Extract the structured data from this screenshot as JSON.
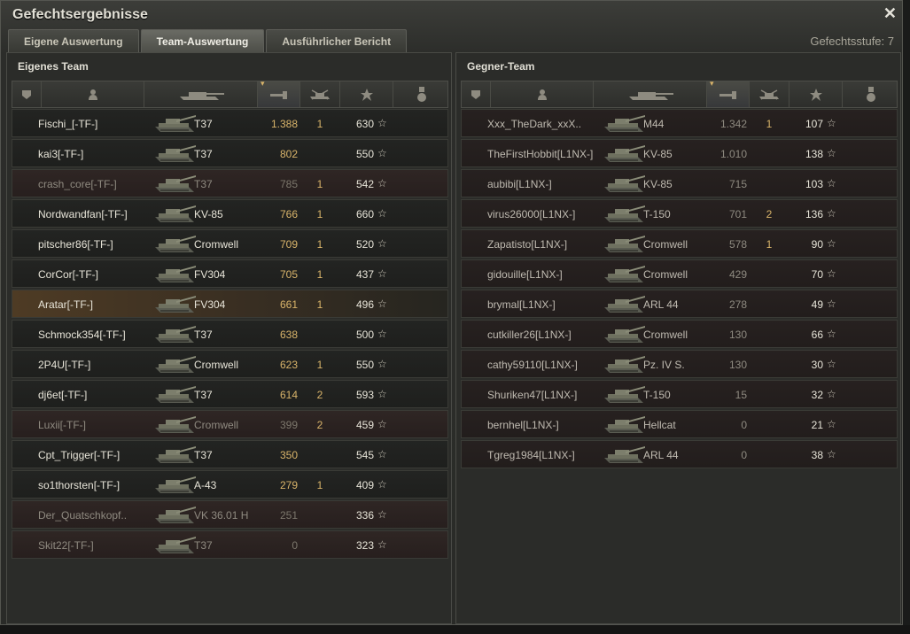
{
  "window": {
    "title": "Gefechtsergebnisse",
    "close_glyph": "✕",
    "battle_level": "Gefechtsstufe: 7"
  },
  "tabs": [
    {
      "label": "Eigene Auswertung",
      "active": false
    },
    {
      "label": "Team-Auswertung",
      "active": true
    },
    {
      "label": "Ausführlicher Bericht",
      "active": false
    }
  ],
  "columns": [
    "platoon-icon",
    "player-icon",
    "tank-icon",
    "xp-icon",
    "kills-icon",
    "points-icon",
    "medal-icon"
  ],
  "star_glyph": "☆",
  "own_team": {
    "title": "Eigenes Team",
    "rows": [
      {
        "name": "Fischi_[-TF-]",
        "tank": "T37",
        "xp": "1.388",
        "kills": "1",
        "points": "630",
        "state": "alive"
      },
      {
        "name": "kai3[-TF-]",
        "tank": "T37",
        "xp": "802",
        "kills": "",
        "points": "550",
        "state": "alive"
      },
      {
        "name": "crash_core[-TF-]",
        "tank": "T37",
        "xp": "785",
        "kills": "1",
        "points": "542",
        "state": "dead"
      },
      {
        "name": "Nordwandfan[-TF-]",
        "tank": "KV-85",
        "xp": "766",
        "kills": "1",
        "points": "660",
        "state": "alive"
      },
      {
        "name": "pitscher86[-TF-]",
        "tank": "Cromwell",
        "xp": "709",
        "kills": "1",
        "points": "520",
        "state": "alive"
      },
      {
        "name": "CorCor[-TF-]",
        "tank": "FV304",
        "xp": "705",
        "kills": "1",
        "points": "437",
        "state": "alive"
      },
      {
        "name": "Aratar[-TF-]",
        "tank": "FV304",
        "xp": "661",
        "kills": "1",
        "points": "496",
        "state": "self"
      },
      {
        "name": "Schmock354[-TF-]",
        "tank": "T37",
        "xp": "638",
        "kills": "",
        "points": "500",
        "state": "alive"
      },
      {
        "name": "2P4U[-TF-]",
        "tank": "Cromwell",
        "xp": "623",
        "kills": "1",
        "points": "550",
        "state": "alive"
      },
      {
        "name": "dj6et[-TF-]",
        "tank": "T37",
        "xp": "614",
        "kills": "2",
        "points": "593",
        "state": "alive"
      },
      {
        "name": "Luxii[-TF-]",
        "tank": "Cromwell",
        "xp": "399",
        "kills": "2",
        "points": "459",
        "state": "dead"
      },
      {
        "name": "Cpt_Trigger[-TF-]",
        "tank": "T37",
        "xp": "350",
        "kills": "",
        "points": "545",
        "state": "alive"
      },
      {
        "name": "so1thorsten[-TF-]",
        "tank": "A-43",
        "xp": "279",
        "kills": "1",
        "points": "409",
        "state": "alive"
      },
      {
        "name": "Der_Quatschkopf..",
        "tank": "VK 36.01 H",
        "xp": "251",
        "kills": "",
        "points": "336",
        "state": "dead"
      },
      {
        "name": "Skit22[-TF-]",
        "tank": "T37",
        "xp": "0",
        "kills": "",
        "points": "323",
        "state": "dead"
      }
    ]
  },
  "enemy_team": {
    "title": "Gegner-Team",
    "rows": [
      {
        "name": "Xxx_TheDark_xxX..",
        "tank": "M44",
        "xp": "1.342",
        "kills": "1",
        "points": "107"
      },
      {
        "name": "TheFirstHobbit[L1NX-]",
        "tank": "KV-85",
        "xp": "1.010",
        "kills": "",
        "points": "138"
      },
      {
        "name": "aubibi[L1NX-]",
        "tank": "KV-85",
        "xp": "715",
        "kills": "",
        "points": "103"
      },
      {
        "name": "virus26000[L1NX-]",
        "tank": "T-150",
        "xp": "701",
        "kills": "2",
        "points": "136"
      },
      {
        "name": "Zapatisto[L1NX-]",
        "tank": "Cromwell",
        "xp": "578",
        "kills": "1",
        "points": "90"
      },
      {
        "name": "gidouille[L1NX-]",
        "tank": "Cromwell",
        "xp": "429",
        "kills": "",
        "points": "70"
      },
      {
        "name": "brymal[L1NX-]",
        "tank": "ARL 44",
        "xp": "278",
        "kills": "",
        "points": "49"
      },
      {
        "name": "cutkiller26[L1NX-]",
        "tank": "Cromwell",
        "xp": "130",
        "kills": "",
        "points": "66"
      },
      {
        "name": "cathy59110[L1NX-]",
        "tank": "Pz. IV S.",
        "xp": "130",
        "kills": "",
        "points": "30"
      },
      {
        "name": "Shuriken47[L1NX-]",
        "tank": "T-150",
        "xp": "15",
        "kills": "",
        "points": "32"
      },
      {
        "name": "bernhel[L1NX-]",
        "tank": "Hellcat",
        "xp": "0",
        "kills": "",
        "points": "21"
      },
      {
        "name": "Tgreg1984[L1NX-]",
        "tank": "ARL 44",
        "xp": "0",
        "kills": "",
        "points": "38"
      }
    ]
  },
  "colors": {
    "accent_gold": "#d9b46a",
    "self_highlight": "#4e3b24",
    "dead_row": "#2f2624"
  }
}
